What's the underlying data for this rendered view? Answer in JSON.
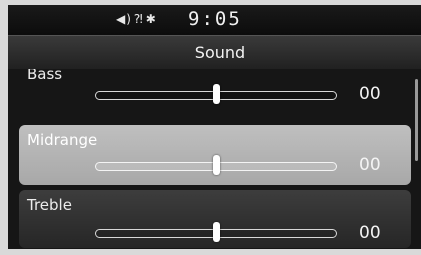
{
  "status": {
    "icons": [
      "volume-icon",
      "phone-signal-icon",
      "bluetooth-icon"
    ],
    "clock": "9:05"
  },
  "title": "Sound",
  "settings": [
    {
      "label": "Bass",
      "value_text": "00",
      "level": 0.5
    },
    {
      "label": "Midrange",
      "value_text": "00",
      "level": 0.5
    },
    {
      "label": "Treble",
      "value_text": "00",
      "level": 0.5
    }
  ],
  "selected_index": 1,
  "colors": {
    "selected_row": "#b3b3b3",
    "row": "#2e2e2e",
    "background": "#161616",
    "text": "#f2f2f2"
  }
}
